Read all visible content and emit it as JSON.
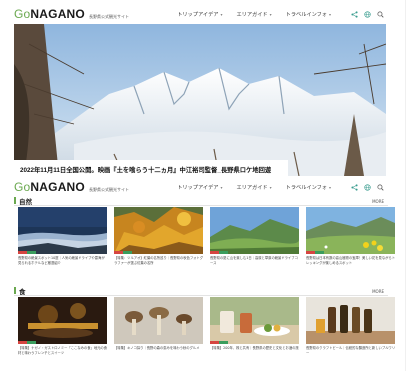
{
  "header": {
    "logo_go": "Go",
    "logo_main": "NAGANO",
    "logo_sub": "長野県公式観光サイト",
    "nav": [
      "トリップアイデア",
      "エリアガイド",
      "トラベルインフォ"
    ],
    "icons": [
      "share-icon",
      "globe-icon",
      "search-icon"
    ]
  },
  "hero": {
    "caption": "2022年11月11日全国公開。映画『土を喰らう十二ヵ月』中江裕司監督_長野県ロケ地回遊"
  },
  "sections": {
    "nature": {
      "title": "自然",
      "more": "MORE",
      "cards": [
        {
          "text": "長野県の絶景スポット10選｜人気の絶景ドライブや雲海が見られるホテルなど厳選紹介",
          "image": "sea-of-clouds"
        },
        {
          "text": "【特集：ツルアオ】紅葉の名所巡り｜長野県の秋色フォトグラファーが選ぶ紅葉の名所",
          "image": "autumn-forest"
        },
        {
          "text": "長野県の夏に山を楽しむ1日｜高原と草原の絶景ドライブコース",
          "image": "mountain-meadow"
        },
        {
          "text": "長野県は日本有数の高山植物の宝庫！美しい花を見ながらトレッキングが楽しめるスポット",
          "image": "alpine-flowers"
        }
      ]
    },
    "food": {
      "title": "食",
      "more": "MORE",
      "cards": [
        {
          "text": "【特集】ナガノ・ガストロノミー「ここなみの食」地元の食材と味わうフレンチとスイーツ",
          "image": "candle-dinner"
        },
        {
          "text": "【特集】キノコ採り｜長野の森の恵みを味わう秋のグルメ",
          "image": "mushrooms"
        },
        {
          "text": "【特集】200年、株と共有｜長野県の歴史と文化とお酒の旅",
          "image": "cafe-table"
        },
        {
          "text": "長野県のクラフトビール｜伝統的な醸造所と新しいブルワリー",
          "image": "beer-bottles"
        }
      ]
    }
  },
  "colors": {
    "accent": "#6aa84f",
    "tag_red": "#d64541",
    "tag_green": "#3a9d5d"
  }
}
